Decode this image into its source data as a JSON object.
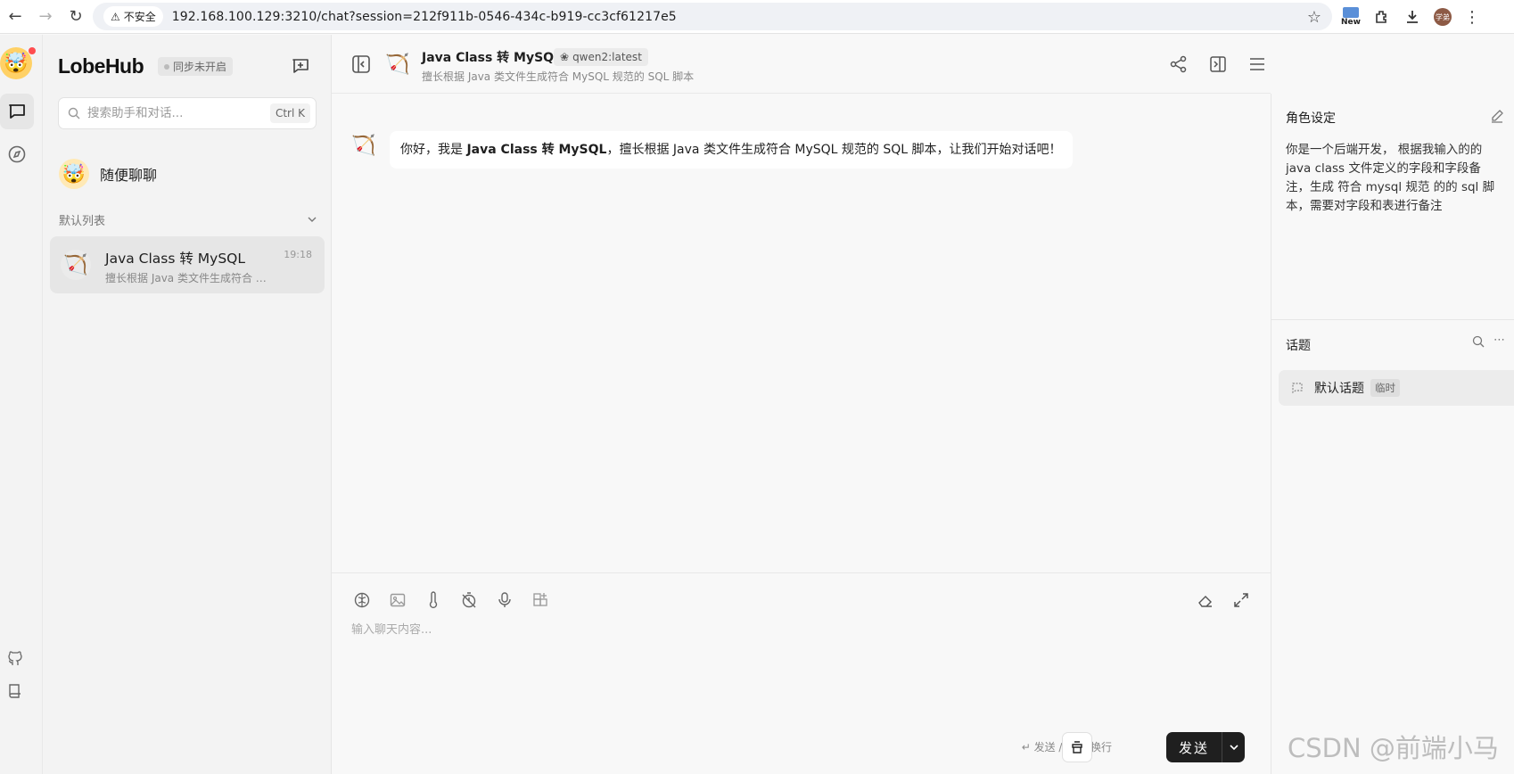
{
  "browser": {
    "insecure_label": "不安全",
    "url": "192.168.100.129:3210/chat?session=212f911b-0546-434c-b919-cc3cf61217e5",
    "new_label": "New",
    "profile_label": "学弟"
  },
  "sidebar": {
    "brand": "LobeHub",
    "sync_status": "同步未开启",
    "search_placeholder": "搜索助手和对话...",
    "search_shortcut": "Ctrl K",
    "random_chat_label": "随便聊聊",
    "group_label": "默认列表",
    "sessions": [
      {
        "title": "Java Class 转 MySQL",
        "desc": "擅长根据 Java 类文件生成符合 MySQL 规范的 SQL 脚本",
        "time": "19:18"
      }
    ]
  },
  "header": {
    "title": "Java Class 转 MySQL",
    "model": "qwen2:latest",
    "description": "擅长根据 Java 类文件生成符合 MySQL 规范的 SQL 脚本"
  },
  "message": {
    "prefix": "你好，我是 ",
    "bold": "Java Class 转 MySQL",
    "suffix": "，擅长根据 Java 类文件生成符合 MySQL 规范的 SQL 脚本，让我们开始对话吧！"
  },
  "input": {
    "placeholder": "输入聊天内容...",
    "hint": "↵ 发送 / ⌃ ↵ 换行",
    "send_label": "发送"
  },
  "right_panel": {
    "role_title": "角色设定",
    "role_text": "你是一个后端开发， 根据我输入的的 java class 文件定义的字段和字段备注，生成 符合 mysql 规范 的的 sql 脚本，需要对字段和表进行备注",
    "topic_title": "话题",
    "topic_name": "默认话题",
    "topic_tag": "临时"
  },
  "watermark": "CSDN @前端小马",
  "colors": {
    "send_button": "#1f1f1f",
    "active_session": "#e6e6e6"
  }
}
